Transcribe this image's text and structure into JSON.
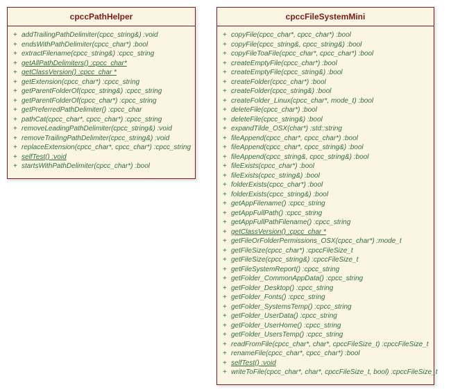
{
  "classes": [
    {
      "name": "cpccPathHelper",
      "methods": [
        {
          "vis": "+",
          "sig": "addTrailingPathDelimiter(cpcc_string&) :void",
          "u": false
        },
        {
          "vis": "+",
          "sig": "endsWithPathDelimiter(cpcc_char*) :bool",
          "u": false
        },
        {
          "vis": "+",
          "sig": "extractFilename(cpcc_string&) :cpcc_string",
          "u": false
        },
        {
          "vis": "+",
          "sig": "getAllPathDelimiters() :cpcc_char*",
          "u": true
        },
        {
          "vis": "+",
          "sig": "getClassVersion() :cpcc_char *",
          "u": true
        },
        {
          "vis": "+",
          "sig": "getExtension(cpcc_char*) :cpcc_string",
          "u": false
        },
        {
          "vis": "+",
          "sig": "getParentFolderOf(cpcc_string&) :cpcc_string",
          "u": false
        },
        {
          "vis": "+",
          "sig": "getParentFolderOf(cpcc_char*) :cpcc_string",
          "u": false
        },
        {
          "vis": "+",
          "sig": "getPreferredPathDelimiter() :cpcc_char",
          "u": false
        },
        {
          "vis": "+",
          "sig": "pathCat(cpcc_char*, cpcc_char*) :cpcc_string",
          "u": false
        },
        {
          "vis": "+",
          "sig": "removeLeadingPathDelimiter(cpcc_string&) :void",
          "u": false
        },
        {
          "vis": "+",
          "sig": "removeTrailingPathDelimiter(cpcc_string&) :void",
          "u": false
        },
        {
          "vis": "+",
          "sig": "replaceExtension(cpcc_char*, cpcc_char*) :cpcc_string",
          "u": false
        },
        {
          "vis": "+",
          "sig": "selfTest() :void",
          "u": true
        },
        {
          "vis": "+",
          "sig": "startsWithPathDelimiter(cpcc_char*) :bool",
          "u": false
        }
      ]
    },
    {
      "name": "cpccFileSystemMini",
      "methods": [
        {
          "vis": "+",
          "sig": "copyFile(cpcc_char*, cpcc_char*) :bool",
          "u": false
        },
        {
          "vis": "+",
          "sig": "copyFile(cpcc_string&, cpcc_string&) :bool",
          "u": false
        },
        {
          "vis": "+",
          "sig": "copyFileToaFile(cpcc_char*, cpcc_char*) :bool",
          "u": false
        },
        {
          "vis": "+",
          "sig": "createEmptyFile(cpcc_char*) :bool",
          "u": false
        },
        {
          "vis": "+",
          "sig": "createEmptyFile(cpcc_string&) :bool",
          "u": false
        },
        {
          "vis": "+",
          "sig": "createFolder(cpcc_char*) :bool",
          "u": false
        },
        {
          "vis": "+",
          "sig": "createFolder(cpcc_string&) :bool",
          "u": false
        },
        {
          "vis": "+",
          "sig": "createFolder_Linux(cpcc_char*, mode_t) :bool",
          "u": false
        },
        {
          "vis": "+",
          "sig": "deleteFile(cpcc_char*) :bool",
          "u": false
        },
        {
          "vis": "+",
          "sig": "deleteFile(cpcc_string&) :bool",
          "u": false
        },
        {
          "vis": "+",
          "sig": "expandTilde_OSX(char*) :std::string",
          "u": false
        },
        {
          "vis": "+",
          "sig": "fileAppend(cpcc_char*, cpcc_char*) :bool",
          "u": false
        },
        {
          "vis": "+",
          "sig": "fileAppend(cpcc_char*, cpcc_string&) :bool",
          "u": false
        },
        {
          "vis": "+",
          "sig": "fileAppend(cpcc_string&, cpcc_string&) :bool",
          "u": false
        },
        {
          "vis": "+",
          "sig": "fileExists(cpcc_char*) :bool",
          "u": false
        },
        {
          "vis": "+",
          "sig": "fileExists(cpcc_string&) :bool",
          "u": false
        },
        {
          "vis": "+",
          "sig": "folderExists(cpcc_char*) :bool",
          "u": false
        },
        {
          "vis": "+",
          "sig": "folderExists(cpcc_string&) :bool",
          "u": false
        },
        {
          "vis": "+",
          "sig": "getAppFilename() :cpcc_string",
          "u": false
        },
        {
          "vis": "+",
          "sig": "getAppFullPath() :cpcc_string",
          "u": false
        },
        {
          "vis": "+",
          "sig": "getAppFullPathFilename() :cpcc_string",
          "u": false
        },
        {
          "vis": "+",
          "sig": "getClassVersion() :cpcc_char *",
          "u": true
        },
        {
          "vis": "+",
          "sig": "getFileOrFolderPermissions_OSX(cpcc_char*) :mode_t",
          "u": false
        },
        {
          "vis": "+",
          "sig": "getFileSize(cpcc_char*) :cpccFileSize_t",
          "u": false
        },
        {
          "vis": "+",
          "sig": "getFileSize(cpcc_string&) :cpccFileSize_t",
          "u": false
        },
        {
          "vis": "+",
          "sig": "getFileSystemReport() :cpcc_string",
          "u": false
        },
        {
          "vis": "+",
          "sig": "getFolder_CommonAppData() :cpcc_string",
          "u": false
        },
        {
          "vis": "+",
          "sig": "getFolder_Desktop() :cpcc_string",
          "u": false
        },
        {
          "vis": "+",
          "sig": "getFolder_Fonts() :cpcc_string",
          "u": false
        },
        {
          "vis": "+",
          "sig": "getFolder_SystemsTemp() :cpcc_string",
          "u": false
        },
        {
          "vis": "+",
          "sig": "getFolder_UserData() :cpcc_string",
          "u": false
        },
        {
          "vis": "+",
          "sig": "getFolder_UserHome() :cpcc_string",
          "u": false
        },
        {
          "vis": "+",
          "sig": "getFolder_UsersTemp() :cpcc_string",
          "u": false
        },
        {
          "vis": "+",
          "sig": "readFromFile(cpcc_char*, char*, cpccFileSize_t) :cpccFileSize_t",
          "u": false
        },
        {
          "vis": "+",
          "sig": "renameFile(cpcc_char*, cpcc_char*) :bool",
          "u": false
        },
        {
          "vis": "+",
          "sig": "selfTest() :void",
          "u": true
        },
        {
          "vis": "+",
          "sig": "writeToFile(cpcc_char*, char*, cpccFileSize_t, bool) :cpccFileSize_t",
          "u": false
        }
      ]
    }
  ]
}
